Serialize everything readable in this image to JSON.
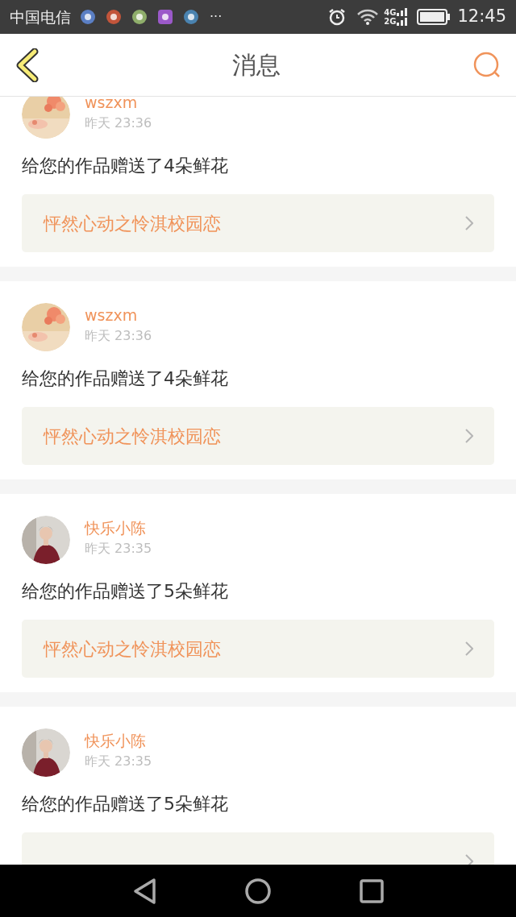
{
  "status_bar": {
    "carrier": "中国电信",
    "more": "···",
    "network_top": "4G",
    "network_bottom": "2G",
    "time": "12:45"
  },
  "header": {
    "title": "消息"
  },
  "messages": [
    {
      "user": "wszxm",
      "time": "昨天 23:36",
      "text": "给您的作品赠送了4朵鲜花",
      "work": "怦然心动之怜淇校园恋"
    },
    {
      "user": "wszxm",
      "time": "昨天 23:36",
      "text": "给您的作品赠送了4朵鲜花",
      "work": "怦然心动之怜淇校园恋"
    },
    {
      "user": "快乐小陈",
      "time": "昨天 23:35",
      "text": "给您的作品赠送了5朵鲜花",
      "work": "怦然心动之怜淇校园恋"
    },
    {
      "user": "快乐小陈",
      "time": "昨天 23:35",
      "text": "给您的作品赠送了5朵鲜花"
    }
  ]
}
